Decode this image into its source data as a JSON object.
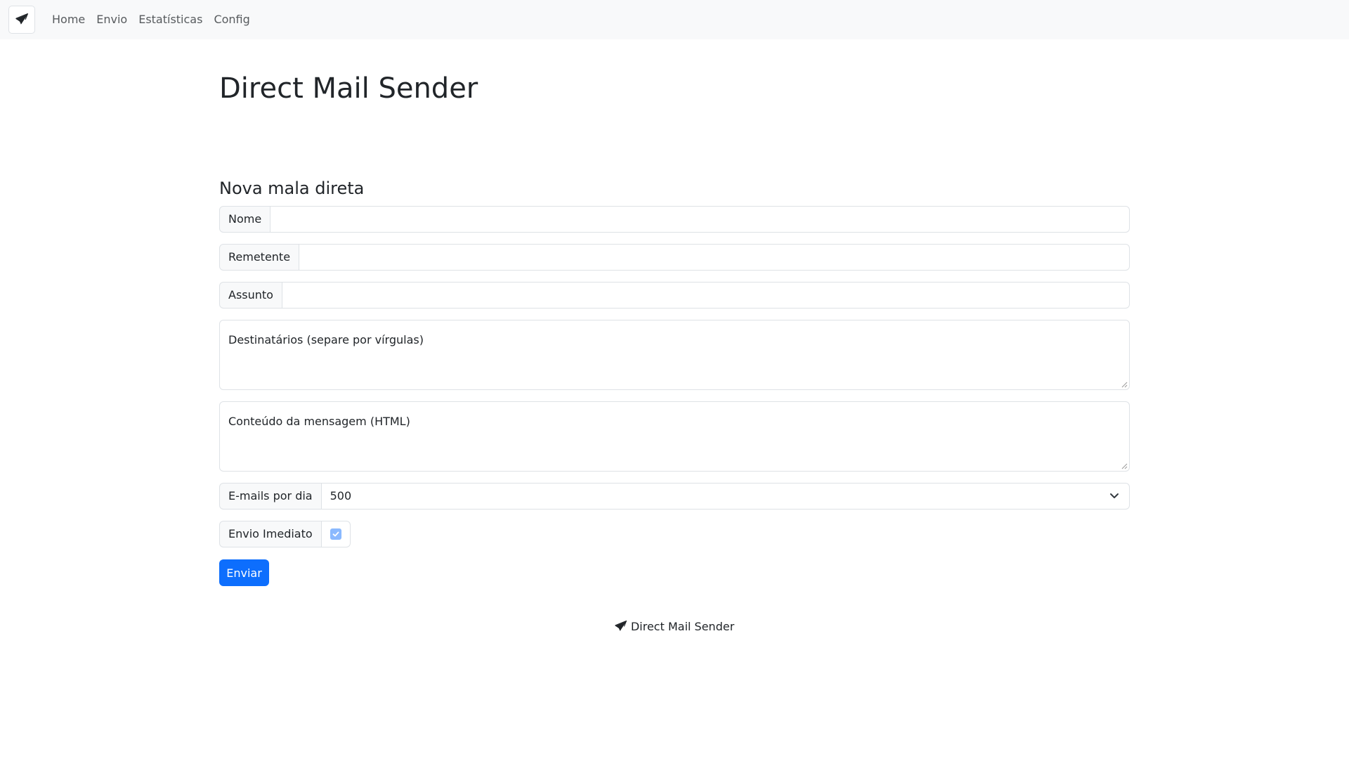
{
  "nav": {
    "brand_icon": "send-icon",
    "links": [
      "Home",
      "Envio",
      "Estatísticas",
      "Config"
    ]
  },
  "page": {
    "title": "Direct Mail Sender",
    "section_title": "Nova mala direta"
  },
  "form": {
    "nome_label": "Nome",
    "nome_value": "",
    "remetente_label": "Remetente",
    "remetente_value": "",
    "assunto_label": "Assunto",
    "assunto_value": "",
    "destinatarios_placeholder": "Destinatários (separe por vírgulas)",
    "conteudo_placeholder": "Conteúdo da mensagem (HTML)",
    "emails_por_dia_label": "E-mails por dia",
    "emails_por_dia_value": "500",
    "envio_imediato_label": "Envio Imediato",
    "envio_imediato_checked": true,
    "submit_label": "Enviar"
  },
  "footer": {
    "text": "Direct Mail Sender",
    "icon": "send-icon"
  },
  "colors": {
    "primary": "#0d6efd",
    "navbar_bg": "#f8f9fa",
    "border": "#dee2e6"
  }
}
